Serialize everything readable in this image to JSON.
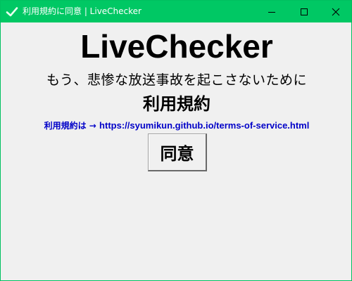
{
  "window": {
    "title": "利用規約に同意 | LiveChecker",
    "titlebar_color": "#00c864",
    "app_icon": "checkmark-icon",
    "controls": [
      "minimize-icon",
      "maximize-icon",
      "close-icon"
    ]
  },
  "main": {
    "app_title": "LiveChecker",
    "tagline": "もう、悲惨な放送事故を起こさないために",
    "terms_heading": "利用規約",
    "terms_prefix": "利用規約は → ",
    "terms_url": "https://syumikun.github.io/terms-of-service.html",
    "link_color": "#0000c8",
    "agree_button": "同意"
  }
}
